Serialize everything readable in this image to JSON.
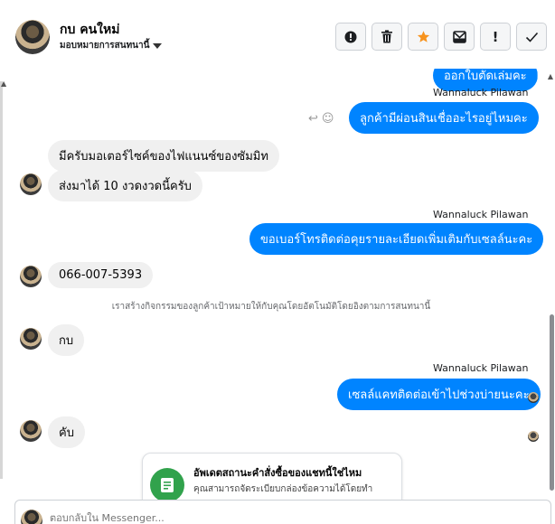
{
  "header": {
    "contact_name": "กบ คนใหม่",
    "contact_subtitle": "มอบหมายการสนทนานี้",
    "actions": [
      "spam-icon",
      "trash-icon",
      "star-icon",
      "mark-unread-icon",
      "important-icon",
      "done-icon"
    ],
    "star_color": "#f7931e"
  },
  "messages": {
    "m1_text": "ออกใบตัดเล่มคะ",
    "m2_sender": "Wannaluck Pilawan",
    "m2_text": "ลูกค้ามีผ่อนสินเชื่ออะไรอยู่ไหมคะ",
    "m3_text": "มีครับมอเตอร์ไซค์ของไฟแนนซ์ของซัมมิท",
    "m4_text": "ส่งมาได้ 10 งวดงวดนี้ครับ",
    "m5_sender": "Wannaluck Pilawan",
    "m5_text": "ขอเบอร์โทรติดต่อคุยรายละเอียดเพิ่มเติมกับเซลล์นะคะ",
    "m6_text": "066-007-5393",
    "system_text": "เราสร้างกิจกรรมของลูกค้าเป้าหมายให้กับคุณโดยอัตโนมัติโดยอิงตามการสนทนานี้",
    "m7_text": "กบ",
    "m8_sender": "Wannaluck Pilawan",
    "m8_text": "เซลล์แคทติดต่อเข้าไปช่วงบ่ายนะคะ",
    "m9_text": "คับ"
  },
  "card": {
    "title": "อัพเดตสถานะคำสั่งซื้อของแชทนี้ใช่ไหม",
    "body": "คุณสามารถจัดระเบียบกล่องข้อความได้โดยทำ"
  },
  "composer": {
    "placeholder": "ตอบกลับใน Messenger..."
  },
  "colors": {
    "outgoing_bubble": "#0084ff",
    "incoming_bubble": "#f0f0f0",
    "card_icon": "#31a24c"
  }
}
